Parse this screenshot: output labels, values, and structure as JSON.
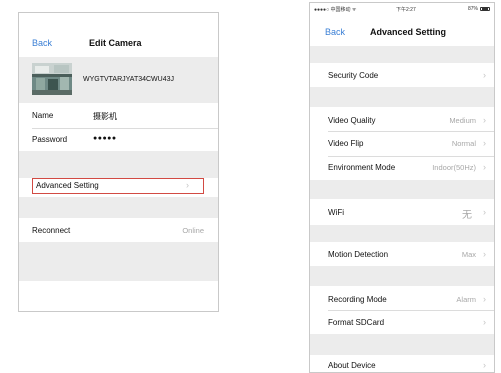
{
  "edit_camera": {
    "back_label": "Back",
    "title": "Edit Camera",
    "camera_id": "WYGTVTARJYAT34CWU43J",
    "name_label": "Name",
    "name_value": "摄影机",
    "password_label": "Password",
    "password_value": "●●●●●",
    "advanced_setting_label": "Advanced Setting",
    "reconnect_label": "Reconnect",
    "reconnect_status": "Online"
  },
  "advanced_setting": {
    "status_bar": {
      "carrier": "●●●●○ 中国移动 ᯤ",
      "time": "下午2:27",
      "battery": "87%"
    },
    "back_label": "Back",
    "title": "Advanced Setting",
    "security_code_label": "Security Code",
    "video_quality_label": "Video Quality",
    "video_quality_value": "Medium",
    "video_flip_label": "Video Flip",
    "video_flip_value": "Normal",
    "environment_mode_label": "Environment Mode",
    "environment_mode_value": "Indoor(50Hz)",
    "wifi_label": "WiFi",
    "wifi_value": "无",
    "motion_detection_label": "Motion Detection",
    "motion_detection_value": "Max",
    "recording_mode_label": "Recording Mode",
    "recording_mode_value": "Alarm",
    "format_sdcard_label": "Format SDCard",
    "about_device_label": "About Device"
  },
  "colors": {
    "accent": "#3a7fd5",
    "highlight_border": "#d24a43",
    "section_gray": "#ececec"
  },
  "icons": {
    "chevron": "chevron-right-icon",
    "battery": "battery-icon",
    "thumbnail": "camera-thumbnail"
  }
}
